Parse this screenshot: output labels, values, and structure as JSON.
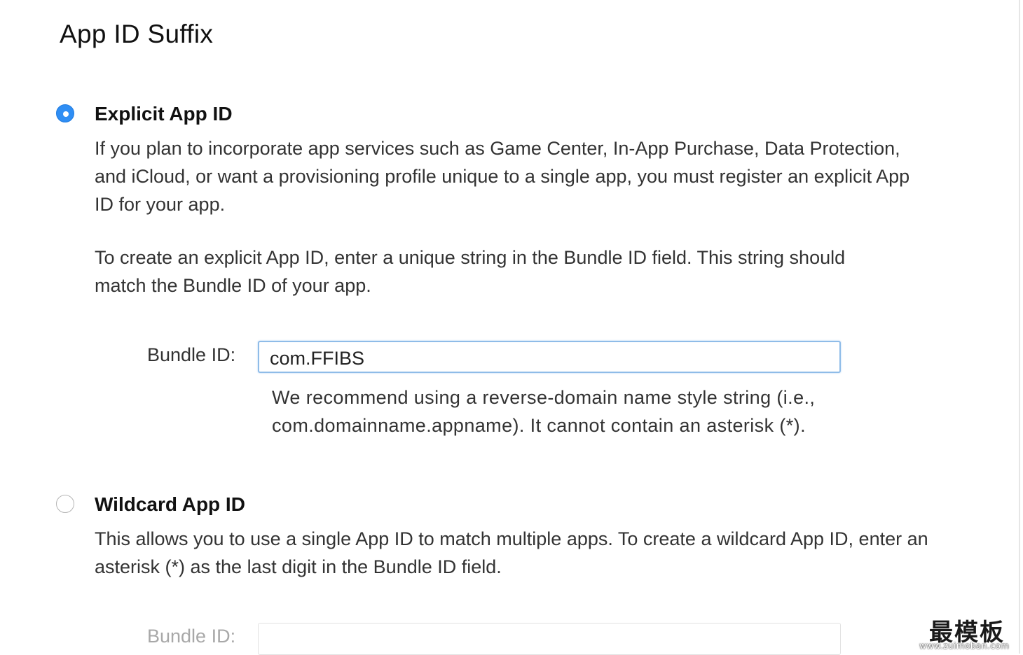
{
  "section": {
    "title": "App ID Suffix"
  },
  "explicit": {
    "title": "Explicit App ID",
    "selected": true,
    "description_1": "If you plan to incorporate app services such as Game Center, In-App Purchase, Data Protection, and iCloud, or want a provisioning profile unique to a single app, you must register an explicit App ID for your app.",
    "description_2": "To create an explicit App ID, enter a unique string in the Bundle ID field. This string should match the Bundle ID of your app.",
    "bundle_label": "Bundle ID:",
    "bundle_value": "com.FFIBS",
    "hint": "We recommend using a reverse-domain name style string (i.e., com.domainname.appname). It cannot contain an asterisk (*)."
  },
  "wildcard": {
    "title": "Wildcard App ID",
    "selected": false,
    "description": "This allows you to use a single App ID to match multiple apps. To create a wildcard App ID, enter an asterisk (*) as the last digit in the Bundle ID field.",
    "bundle_label": "Bundle ID:",
    "bundle_value": ""
  },
  "watermark": {
    "main": "最模板",
    "sub": "www.zuimoban.com"
  },
  "colors": {
    "accent": "#2f8ef4",
    "input_focus_border": "#8fbce8",
    "disabled_text": "#a8a8a8"
  }
}
